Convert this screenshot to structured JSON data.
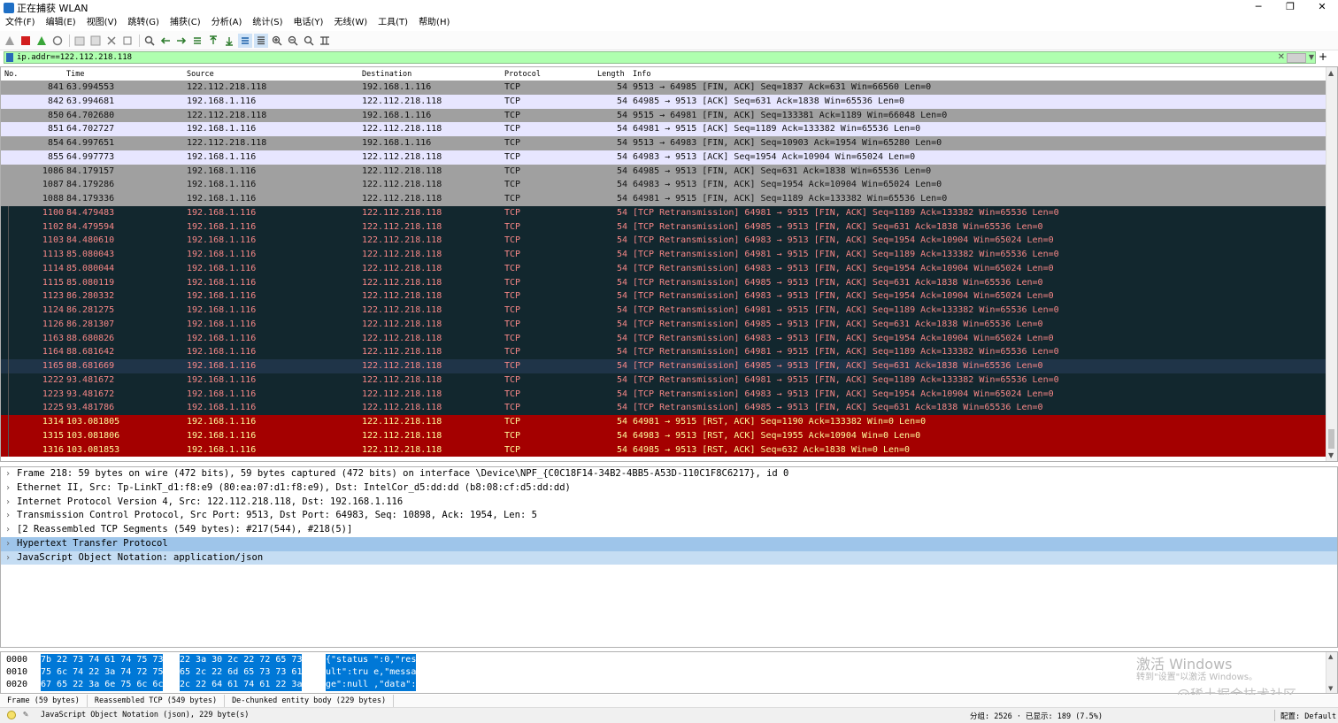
{
  "window": {
    "title": "正在捕获 WLAN",
    "minimize": "─",
    "restore": "❐",
    "close": "✕"
  },
  "menu": [
    "文件(F)",
    "编辑(E)",
    "视图(V)",
    "跳转(G)",
    "捕获(C)",
    "分析(A)",
    "统计(S)",
    "电话(Y)",
    "无线(W)",
    "工具(T)",
    "帮助(H)"
  ],
  "filter": {
    "value": "ip.addr==122.112.218.118"
  },
  "columns": {
    "no": "No.",
    "time": "Time",
    "source": "Source",
    "destination": "Destination",
    "protocol": "Protocol",
    "length": "Length",
    "info": "Info"
  },
  "packets": [
    {
      "no": "841",
      "time": "63.994553",
      "src": "122.112.218.118",
      "dst": "192.168.1.116",
      "proto": "TCP",
      "len": "54",
      "info": "9513 → 64985 [FIN, ACK] Seq=1837 Ack=631 Win=66560 Len=0",
      "type": "fin"
    },
    {
      "no": "842",
      "time": "63.994681",
      "src": "192.168.1.116",
      "dst": "122.112.218.118",
      "proto": "TCP",
      "len": "54",
      "info": "64985 → 9513 [ACK] Seq=631 Ack=1838 Win=65536 Len=0",
      "type": "ack"
    },
    {
      "no": "850",
      "time": "64.702680",
      "src": "122.112.218.118",
      "dst": "192.168.1.116",
      "proto": "TCP",
      "len": "54",
      "info": "9515 → 64981 [FIN, ACK] Seq=133381 Ack=1189 Win=66048 Len=0",
      "type": "fin"
    },
    {
      "no": "851",
      "time": "64.702727",
      "src": "192.168.1.116",
      "dst": "122.112.218.118",
      "proto": "TCP",
      "len": "54",
      "info": "64981 → 9515 [ACK] Seq=1189 Ack=133382 Win=65536 Len=0",
      "type": "ack"
    },
    {
      "no": "854",
      "time": "64.997651",
      "src": "122.112.218.118",
      "dst": "192.168.1.116",
      "proto": "TCP",
      "len": "54",
      "info": "9513 → 64983 [FIN, ACK] Seq=10903 Ack=1954 Win=65280 Len=0",
      "type": "fin"
    },
    {
      "no": "855",
      "time": "64.997773",
      "src": "192.168.1.116",
      "dst": "122.112.218.118",
      "proto": "TCP",
      "len": "54",
      "info": "64983 → 9513 [ACK] Seq=1954 Ack=10904 Win=65024 Len=0",
      "type": "ack"
    },
    {
      "no": "1086",
      "time": "84.179157",
      "src": "192.168.1.116",
      "dst": "122.112.218.118",
      "proto": "TCP",
      "len": "54",
      "info": "64985 → 9513 [FIN, ACK] Seq=631 Ack=1838 Win=65536 Len=0",
      "type": "fin"
    },
    {
      "no": "1087",
      "time": "84.179286",
      "src": "192.168.1.116",
      "dst": "122.112.218.118",
      "proto": "TCP",
      "len": "54",
      "info": "64983 → 9513 [FIN, ACK] Seq=1954 Ack=10904 Win=65024 Len=0",
      "type": "fin"
    },
    {
      "no": "1088",
      "time": "84.179336",
      "src": "192.168.1.116",
      "dst": "122.112.218.118",
      "proto": "TCP",
      "len": "54",
      "info": "64981 → 9515 [FIN, ACK] Seq=1189 Ack=133382 Win=65536 Len=0",
      "type": "fin"
    },
    {
      "no": "1100",
      "time": "84.479483",
      "src": "192.168.1.116",
      "dst": "122.112.218.118",
      "proto": "TCP",
      "len": "54",
      "info": "[TCP Retransmission] 64981 → 9515 [FIN, ACK] Seq=1189 Ack=133382 Win=65536 Len=0",
      "type": "retr"
    },
    {
      "no": "1102",
      "time": "84.479594",
      "src": "192.168.1.116",
      "dst": "122.112.218.118",
      "proto": "TCP",
      "len": "54",
      "info": "[TCP Retransmission] 64985 → 9513 [FIN, ACK] Seq=631 Ack=1838 Win=65536 Len=0",
      "type": "retr"
    },
    {
      "no": "1103",
      "time": "84.480610",
      "src": "192.168.1.116",
      "dst": "122.112.218.118",
      "proto": "TCP",
      "len": "54",
      "info": "[TCP Retransmission] 64983 → 9513 [FIN, ACK] Seq=1954 Ack=10904 Win=65024 Len=0",
      "type": "retr"
    },
    {
      "no": "1113",
      "time": "85.080043",
      "src": "192.168.1.116",
      "dst": "122.112.218.118",
      "proto": "TCP",
      "len": "54",
      "info": "[TCP Retransmission] 64981 → 9515 [FIN, ACK] Seq=1189 Ack=133382 Win=65536 Len=0",
      "type": "retr"
    },
    {
      "no": "1114",
      "time": "85.080044",
      "src": "192.168.1.116",
      "dst": "122.112.218.118",
      "proto": "TCP",
      "len": "54",
      "info": "[TCP Retransmission] 64983 → 9513 [FIN, ACK] Seq=1954 Ack=10904 Win=65024 Len=0",
      "type": "retr"
    },
    {
      "no": "1115",
      "time": "85.080119",
      "src": "192.168.1.116",
      "dst": "122.112.218.118",
      "proto": "TCP",
      "len": "54",
      "info": "[TCP Retransmission] 64985 → 9513 [FIN, ACK] Seq=631 Ack=1838 Win=65536 Len=0",
      "type": "retr"
    },
    {
      "no": "1123",
      "time": "86.280332",
      "src": "192.168.1.116",
      "dst": "122.112.218.118",
      "proto": "TCP",
      "len": "54",
      "info": "[TCP Retransmission] 64983 → 9513 [FIN, ACK] Seq=1954 Ack=10904 Win=65024 Len=0",
      "type": "retr"
    },
    {
      "no": "1124",
      "time": "86.281275",
      "src": "192.168.1.116",
      "dst": "122.112.218.118",
      "proto": "TCP",
      "len": "54",
      "info": "[TCP Retransmission] 64981 → 9515 [FIN, ACK] Seq=1189 Ack=133382 Win=65536 Len=0",
      "type": "retr"
    },
    {
      "no": "1126",
      "time": "86.281307",
      "src": "192.168.1.116",
      "dst": "122.112.218.118",
      "proto": "TCP",
      "len": "54",
      "info": "[TCP Retransmission] 64985 → 9513 [FIN, ACK] Seq=631 Ack=1838 Win=65536 Len=0",
      "type": "retr"
    },
    {
      "no": "1163",
      "time": "88.680826",
      "src": "192.168.1.116",
      "dst": "122.112.218.118",
      "proto": "TCP",
      "len": "54",
      "info": "[TCP Retransmission] 64983 → 9513 [FIN, ACK] Seq=1954 Ack=10904 Win=65024 Len=0",
      "type": "retr"
    },
    {
      "no": "1164",
      "time": "88.681642",
      "src": "192.168.1.116",
      "dst": "122.112.218.118",
      "proto": "TCP",
      "len": "54",
      "info": "[TCP Retransmission] 64981 → 9515 [FIN, ACK] Seq=1189 Ack=133382 Win=65536 Len=0",
      "type": "retr"
    },
    {
      "no": "1165",
      "time": "88.681669",
      "src": "192.168.1.116",
      "dst": "122.112.218.118",
      "proto": "TCP",
      "len": "54",
      "info": "[TCP Retransmission] 64985 → 9513 [FIN, ACK] Seq=631 Ack=1838 Win=65536 Len=0",
      "type": "retr-sel"
    },
    {
      "no": "1222",
      "time": "93.481672",
      "src": "192.168.1.116",
      "dst": "122.112.218.118",
      "proto": "TCP",
      "len": "54",
      "info": "[TCP Retransmission] 64981 → 9515 [FIN, ACK] Seq=1189 Ack=133382 Win=65536 Len=0",
      "type": "retr"
    },
    {
      "no": "1223",
      "time": "93.481672",
      "src": "192.168.1.116",
      "dst": "122.112.218.118",
      "proto": "TCP",
      "len": "54",
      "info": "[TCP Retransmission] 64983 → 9513 [FIN, ACK] Seq=1954 Ack=10904 Win=65024 Len=0",
      "type": "retr"
    },
    {
      "no": "1225",
      "time": "93.481786",
      "src": "192.168.1.116",
      "dst": "122.112.218.118",
      "proto": "TCP",
      "len": "54",
      "info": "[TCP Retransmission] 64985 → 9513 [FIN, ACK] Seq=631 Ack=1838 Win=65536 Len=0",
      "type": "retr"
    },
    {
      "no": "1314",
      "time": "103.081805",
      "src": "192.168.1.116",
      "dst": "122.112.218.118",
      "proto": "TCP",
      "len": "54",
      "info": "64981 → 9515 [RST, ACK] Seq=1190 Ack=133382 Win=0 Len=0",
      "type": "rst"
    },
    {
      "no": "1315",
      "time": "103.081806",
      "src": "192.168.1.116",
      "dst": "122.112.218.118",
      "proto": "TCP",
      "len": "54",
      "info": "64983 → 9513 [RST, ACK] Seq=1955 Ack=10904 Win=0 Len=0",
      "type": "rst"
    },
    {
      "no": "1316",
      "time": "103.081853",
      "src": "192.168.1.116",
      "dst": "122.112.218.118",
      "proto": "TCP",
      "len": "54",
      "info": "64985 → 9513 [RST, ACK] Seq=632 Ack=1838 Win=0 Len=0",
      "type": "rst"
    }
  ],
  "details": [
    {
      "text": "Frame 218: 59 bytes on wire (472 bits), 59 bytes captured (472 bits) on interface \\Device\\NPF_{C0C18F14-34B2-4BB5-A53D-110C1F8C6217}, id 0",
      "hl": ""
    },
    {
      "text": "Ethernet II, Src: Tp-LinkT_d1:f8:e9 (80:ea:07:d1:f8:e9), Dst: IntelCor_d5:dd:dd (b8:08:cf:d5:dd:dd)",
      "hl": ""
    },
    {
      "text": "Internet Protocol Version 4, Src: 122.112.218.118, Dst: 192.168.1.116",
      "hl": ""
    },
    {
      "text": "Transmission Control Protocol, Src Port: 9513, Dst Port: 64983, Seq: 10898, Ack: 1954, Len: 5",
      "hl": ""
    },
    {
      "text": "[2 Reassembled TCP Segments (549 bytes): #217(544), #218(5)]",
      "hl": ""
    },
    {
      "text": "Hypertext Transfer Protocol",
      "hl": "hl"
    },
    {
      "text": "JavaScript Object Notation: application/json",
      "hl": "hl2"
    }
  ],
  "bytes": [
    {
      "offset": "0000",
      "hex1": "7b 22 73 74 61 74 75 73",
      "hex2": "22 3a 30 2c 22 72 65 73",
      "ascii": "{\"status \":0,\"res"
    },
    {
      "offset": "0010",
      "hex1": "75 6c 74 22 3a 74 72 75",
      "hex2": "65 2c 22 6d 65 73 73 61",
      "ascii": "ult\":tru e,\"messa"
    },
    {
      "offset": "0020",
      "hex1": "67 65 22 3a 6e 75 6c 6c",
      "hex2": "2c 22 64 61 74 61 22 3a",
      "ascii": "ge\":null ,\"data\":"
    }
  ],
  "watermark": {
    "line1": "激活 Windows",
    "line2": "转到\"设置\"以激活 Windows。",
    "site": "@稀土掘金技术社区"
  },
  "byte_tabs": [
    "Frame (59 bytes)",
    "Reassembled TCP (549 bytes)",
    "De-chunked entity body (229 bytes)"
  ],
  "status": {
    "left": "JavaScript Object Notation (json), 229 byte(s)",
    "mid": "分组: 2526 · 已显示: 189 (7.5%)",
    "right": "配置: Default"
  }
}
